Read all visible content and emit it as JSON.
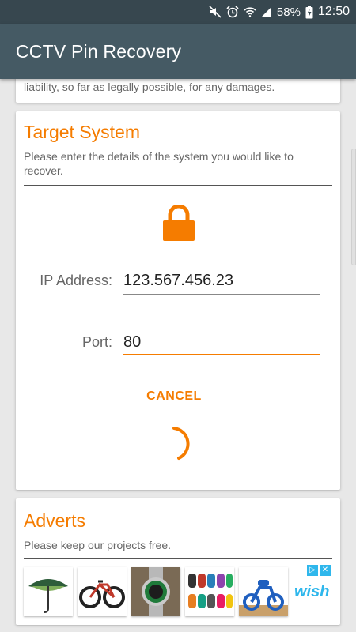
{
  "status_bar": {
    "battery": "58%",
    "time": "12:50"
  },
  "app_bar": {
    "title": "CCTV Pin Recovery"
  },
  "disclaimer_card": {
    "visible_text": "liability, so far as legally possible, for any damages."
  },
  "target_card": {
    "title": "Target System",
    "subtitle": "Please enter the details of the system you would like to recover.",
    "ip_label": "IP Address:",
    "ip_value": "123.567.456.23",
    "port_label": "Port:",
    "port_value": "80",
    "cancel_label": "CANCEL"
  },
  "adverts_card": {
    "title": "Adverts",
    "subtitle": "Please keep our projects free.",
    "ads": [
      {
        "icon": "umbrella-icon"
      },
      {
        "icon": "bicycle-icon"
      },
      {
        "icon": "watch-icon"
      },
      {
        "icon": "bracelets-icon"
      },
      {
        "icon": "toy-bike-icon"
      }
    ],
    "advertiser": "wish"
  },
  "colors": {
    "accent": "#f57c00",
    "app_bar": "#455a64",
    "status_bar": "#37474f"
  }
}
